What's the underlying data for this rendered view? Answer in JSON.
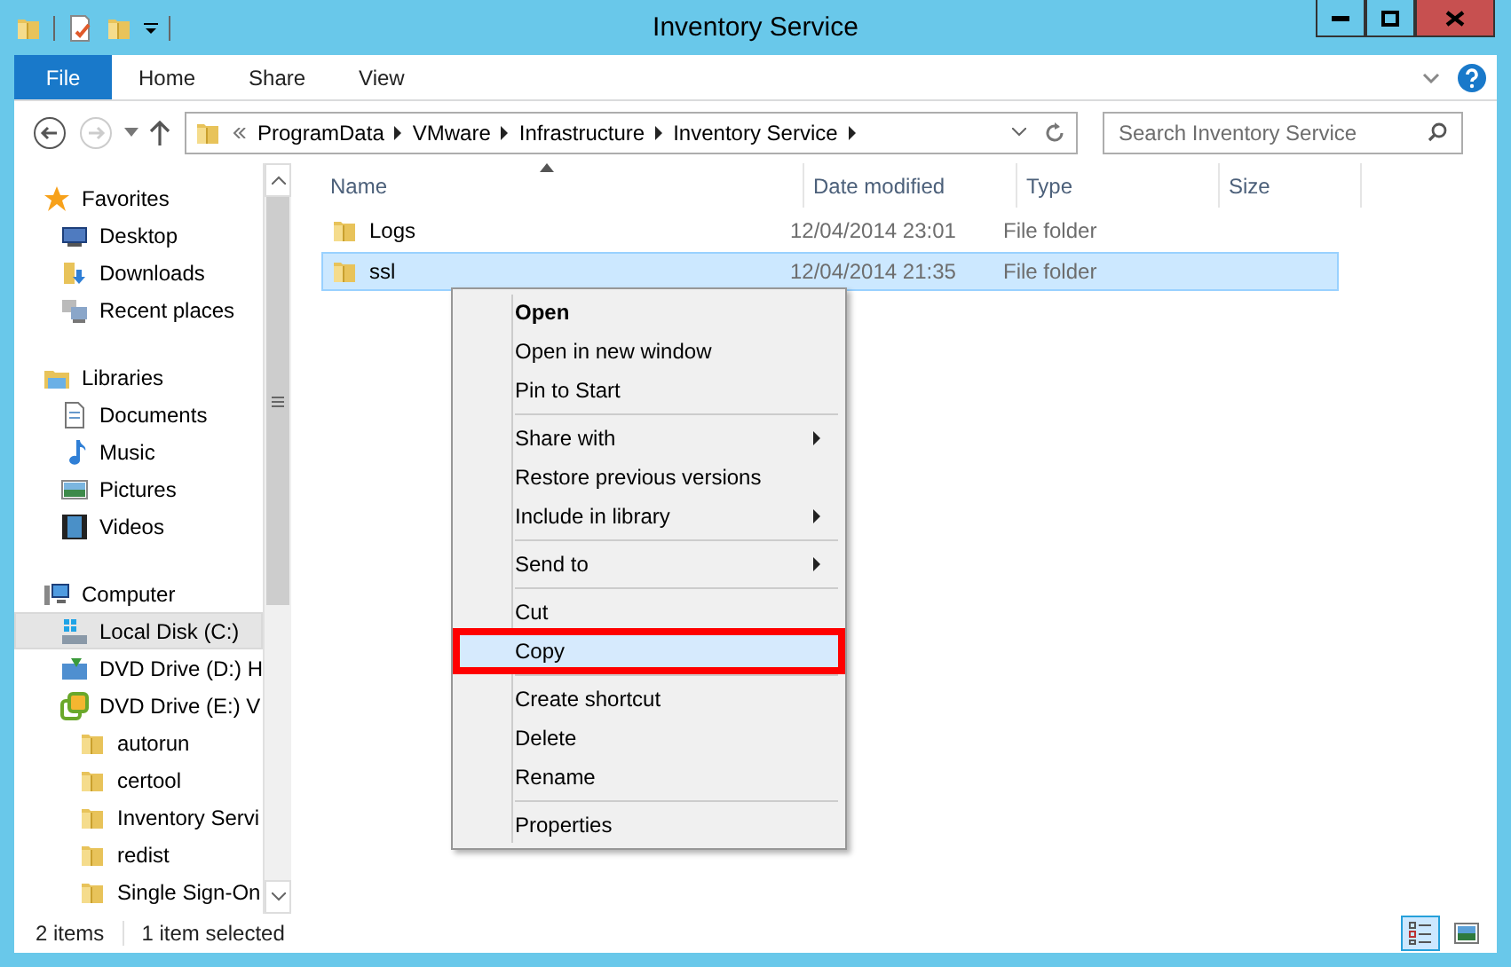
{
  "window": {
    "title": "Inventory Service"
  },
  "ribbon": {
    "tabs": [
      {
        "label": "File",
        "kind": "file"
      },
      {
        "label": "Home",
        "kind": "tab"
      },
      {
        "label": "Share",
        "kind": "tab"
      },
      {
        "label": "View",
        "kind": "tab"
      }
    ]
  },
  "address": {
    "path": [
      "ProgramData",
      "VMware",
      "Infrastructure",
      "Inventory Service"
    ]
  },
  "search": {
    "placeholder": "Search Inventory Service"
  },
  "navigation": [
    {
      "label": "Favorites",
      "kind": "star",
      "selected": false,
      "children": [
        {
          "label": "Desktop",
          "kind": "desktop",
          "selected": false
        },
        {
          "label": "Downloads",
          "kind": "downloads",
          "selected": false
        },
        {
          "label": "Recent places",
          "kind": "recent",
          "selected": false
        }
      ]
    },
    {
      "label": "Libraries",
      "kind": "library",
      "selected": false,
      "children": [
        {
          "label": "Documents",
          "kind": "document",
          "selected": false
        },
        {
          "label": "Music",
          "kind": "music",
          "selected": false
        },
        {
          "label": "Pictures",
          "kind": "pictures",
          "selected": false
        },
        {
          "label": "Videos",
          "kind": "video",
          "selected": false
        }
      ]
    },
    {
      "label": "Computer",
      "kind": "computer",
      "selected": false,
      "children": [
        {
          "label": "Local Disk (C:)",
          "kind": "disk",
          "selected": true
        },
        {
          "label": "DVD Drive (D:) H",
          "kind": "dvd",
          "selected": false
        },
        {
          "label": "DVD Drive (E:) V",
          "kind": "dvd-vm",
          "selected": false,
          "children": [
            {
              "label": "autorun",
              "kind": "folder",
              "selected": false
            },
            {
              "label": "certool",
              "kind": "folder",
              "selected": false
            },
            {
              "label": "Inventory Servi",
              "kind": "folder",
              "selected": false
            },
            {
              "label": "redist",
              "kind": "folder",
              "selected": false
            },
            {
              "label": "Single Sign-On",
              "kind": "folder",
              "selected": false
            }
          ]
        }
      ]
    }
  ],
  "files": {
    "columns": [
      "Name",
      "Date modified",
      "Type",
      "Size"
    ],
    "rows": [
      {
        "name": "Logs",
        "date": "12/04/2014 23:01",
        "type": "File folder",
        "selected": false
      },
      {
        "name": "ssl",
        "date": "12/04/2014 21:35",
        "type": "File folder",
        "selected": true
      }
    ]
  },
  "context_menu": {
    "sections": [
      [
        {
          "label": "Open",
          "default": true,
          "submenu": false,
          "highlighted": false
        },
        {
          "label": "Open in new window",
          "default": false,
          "submenu": false,
          "highlighted": false
        },
        {
          "label": "Pin to Start",
          "default": false,
          "submenu": false,
          "highlighted": false
        }
      ],
      [
        {
          "label": "Share with",
          "default": false,
          "submenu": true,
          "highlighted": false
        },
        {
          "label": "Restore previous versions",
          "default": false,
          "submenu": false,
          "highlighted": false
        },
        {
          "label": "Include in library",
          "default": false,
          "submenu": true,
          "highlighted": false
        }
      ],
      [
        {
          "label": "Send to",
          "default": false,
          "submenu": true,
          "highlighted": false
        }
      ],
      [
        {
          "label": "Cut",
          "default": false,
          "submenu": false,
          "highlighted": false
        },
        {
          "label": "Copy",
          "default": false,
          "submenu": false,
          "highlighted": true
        }
      ],
      [
        {
          "label": "Create shortcut",
          "default": false,
          "submenu": false,
          "highlighted": false
        },
        {
          "label": "Delete",
          "default": false,
          "submenu": false,
          "highlighted": false
        },
        {
          "label": "Rename",
          "default": false,
          "submenu": false,
          "highlighted": false
        }
      ],
      [
        {
          "label": "Properties",
          "default": false,
          "submenu": false,
          "highlighted": false
        }
      ]
    ]
  },
  "status_bar": {
    "item_count": "2 items",
    "selection": "1 item selected",
    "views": [
      {
        "kind": "details",
        "selected": true
      },
      {
        "kind": "large-icons",
        "selected": false
      }
    ]
  }
}
